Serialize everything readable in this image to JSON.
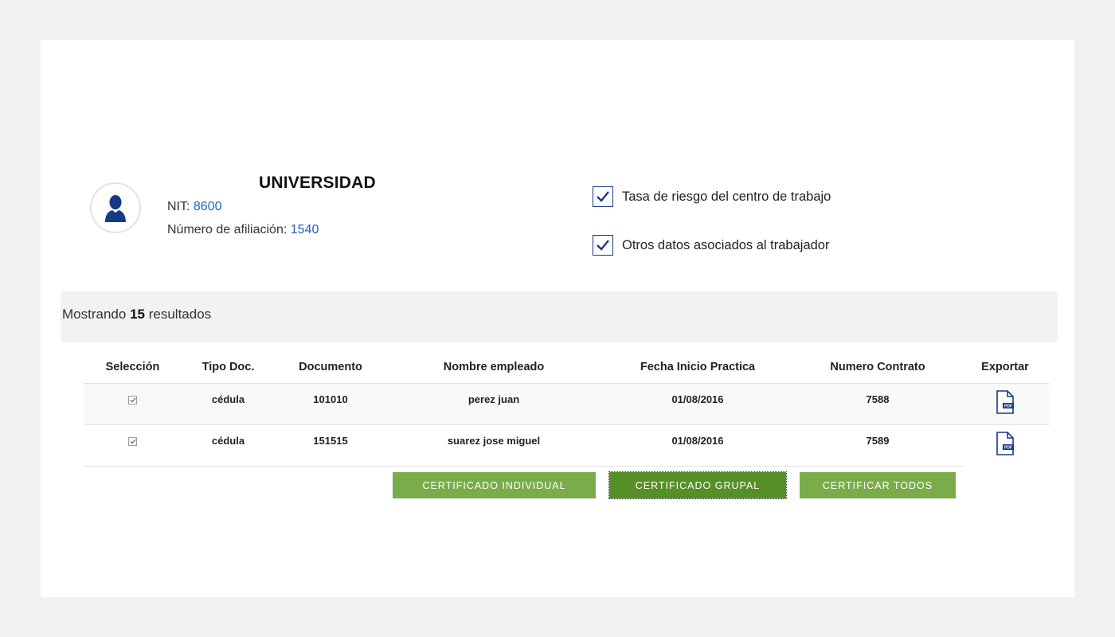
{
  "company": {
    "name": "UNIVERSIDAD",
    "nit_label": "NIT:",
    "nit_value": "8600",
    "affiliation_label": "Número de afiliación:",
    "affiliation_value": "1540"
  },
  "options": [
    {
      "label": "Tasa de riesgo del centro de trabajo",
      "checked": true
    },
    {
      "label": "Otros datos asociados al trabajador",
      "checked": true
    }
  ],
  "results": {
    "prefix": "Mostrando",
    "count": "15",
    "suffix": "resultados"
  },
  "table": {
    "headers": [
      "Selección",
      "Tipo Doc.",
      "Documento",
      "Nombre empleado",
      "Fecha Inicio Practica",
      "Numero Contrato",
      "Exportar"
    ],
    "rows": [
      {
        "selected": true,
        "tipo": "cédula",
        "documento": "101010",
        "nombre": "perez juan",
        "fecha": "01/08/2016",
        "contrato": "7588",
        "export_icon": "pdf-icon"
      },
      {
        "selected": true,
        "tipo": "cédula",
        "documento": "151515",
        "nombre": "suarez jose miguel",
        "fecha": "01/08/2016",
        "contrato": "7589",
        "export_icon": "pdf-icon"
      }
    ]
  },
  "buttons": {
    "individual": "CERTIFICADO INDIVIDUAL",
    "grupal": "CERTIFICADO GRUPAL",
    "todos": "CERTIFICAR TODOS"
  },
  "colors": {
    "accent_blue": "#163a86",
    "link_blue": "#1f5fc4",
    "button_green": "#7aac4a",
    "button_green_active": "#568f26"
  }
}
